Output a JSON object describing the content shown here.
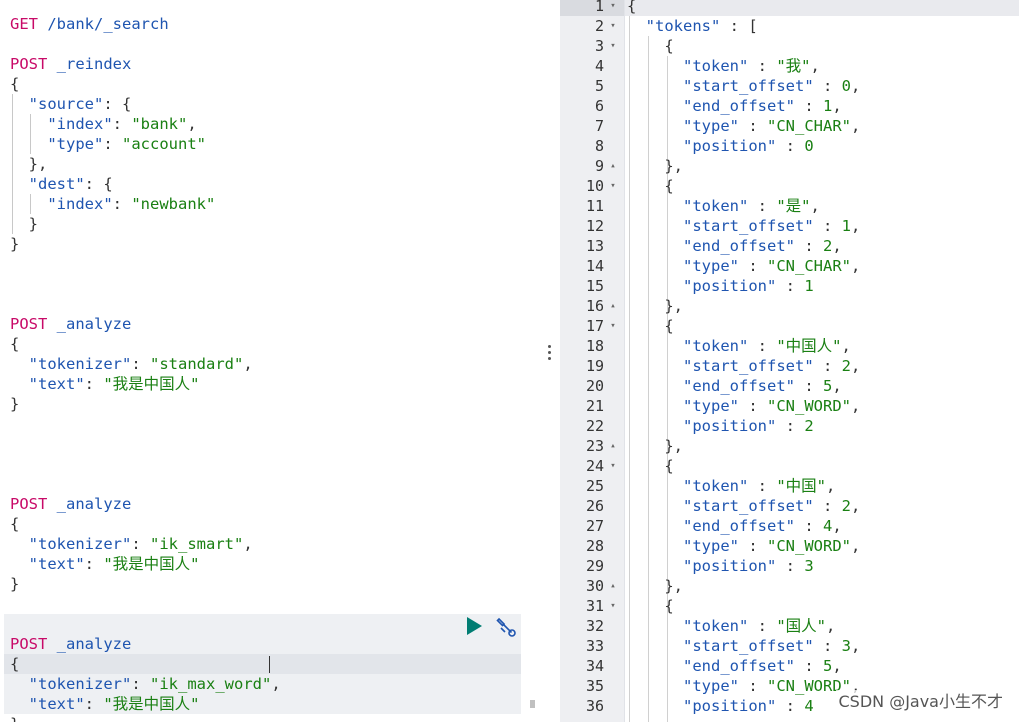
{
  "request_editor": {
    "lines": [
      [
        {
          "c": "tok-method",
          "t": "GET"
        },
        {
          "c": "tok-punc",
          "t": " "
        },
        {
          "c": "tok-path",
          "t": "/bank/_search"
        }
      ],
      [],
      [
        {
          "c": "tok-method",
          "t": "POST"
        },
        {
          "c": "tok-punc",
          "t": " "
        },
        {
          "c": "tok-path",
          "t": "_reindex"
        }
      ],
      [
        {
          "c": "tok-punc",
          "t": "{"
        }
      ],
      [
        {
          "c": "tok-punc",
          "t": "  "
        },
        {
          "c": "tok-key",
          "t": "\"source\""
        },
        {
          "c": "tok-punc",
          "t": ": {"
        }
      ],
      [
        {
          "c": "tok-punc",
          "t": "    "
        },
        {
          "c": "tok-key",
          "t": "\"index\""
        },
        {
          "c": "tok-punc",
          "t": ": "
        },
        {
          "c": "tok-str",
          "t": "\"bank\""
        },
        {
          "c": "tok-punc",
          "t": ","
        }
      ],
      [
        {
          "c": "tok-punc",
          "t": "    "
        },
        {
          "c": "tok-key",
          "t": "\"type\""
        },
        {
          "c": "tok-punc",
          "t": ": "
        },
        {
          "c": "tok-str",
          "t": "\"account\""
        }
      ],
      [
        {
          "c": "tok-punc",
          "t": "  },"
        }
      ],
      [
        {
          "c": "tok-punc",
          "t": "  "
        },
        {
          "c": "tok-key",
          "t": "\"dest\""
        },
        {
          "c": "tok-punc",
          "t": ": {"
        }
      ],
      [
        {
          "c": "tok-punc",
          "t": "    "
        },
        {
          "c": "tok-key",
          "t": "\"index\""
        },
        {
          "c": "tok-punc",
          "t": ": "
        },
        {
          "c": "tok-str",
          "t": "\"newbank\""
        }
      ],
      [
        {
          "c": "tok-punc",
          "t": "  }"
        }
      ],
      [
        {
          "c": "tok-punc",
          "t": "}"
        }
      ],
      [],
      [],
      [],
      [
        {
          "c": "tok-method",
          "t": "POST"
        },
        {
          "c": "tok-punc",
          "t": " "
        },
        {
          "c": "tok-path",
          "t": "_analyze"
        }
      ],
      [
        {
          "c": "tok-punc",
          "t": "{"
        }
      ],
      [
        {
          "c": "tok-punc",
          "t": "  "
        },
        {
          "c": "tok-key",
          "t": "\"tokenizer\""
        },
        {
          "c": "tok-punc",
          "t": ": "
        },
        {
          "c": "tok-str",
          "t": "\"standard\""
        },
        {
          "c": "tok-punc",
          "t": ","
        }
      ],
      [
        {
          "c": "tok-punc",
          "t": "  "
        },
        {
          "c": "tok-key",
          "t": "\"text\""
        },
        {
          "c": "tok-punc",
          "t": ": "
        },
        {
          "c": "tok-str",
          "t": "\"我是中国人\""
        }
      ],
      [
        {
          "c": "tok-punc",
          "t": "}"
        }
      ],
      [],
      [],
      [],
      [],
      [
        {
          "c": "tok-method",
          "t": "POST"
        },
        {
          "c": "tok-punc",
          "t": " "
        },
        {
          "c": "tok-path",
          "t": "_analyze"
        }
      ],
      [
        {
          "c": "tok-punc",
          "t": "{"
        }
      ],
      [
        {
          "c": "tok-punc",
          "t": "  "
        },
        {
          "c": "tok-key",
          "t": "\"tokenizer\""
        },
        {
          "c": "tok-punc",
          "t": ": "
        },
        {
          "c": "tok-str",
          "t": "\"ik_smart\""
        },
        {
          "c": "tok-punc",
          "t": ","
        }
      ],
      [
        {
          "c": "tok-punc",
          "t": "  "
        },
        {
          "c": "tok-key",
          "t": "\"text\""
        },
        {
          "c": "tok-punc",
          "t": ": "
        },
        {
          "c": "tok-str",
          "t": "\"我是中国人\""
        }
      ],
      [
        {
          "c": "tok-punc",
          "t": "}"
        }
      ],
      [],
      [],
      [
        {
          "c": "tok-method",
          "t": "POST"
        },
        {
          "c": "tok-punc",
          "t": " "
        },
        {
          "c": "tok-path",
          "t": "_analyze"
        }
      ],
      [
        {
          "c": "tok-punc",
          "t": "{"
        }
      ],
      [
        {
          "c": "tok-punc",
          "t": "  "
        },
        {
          "c": "tok-key",
          "t": "\"tokenizer\""
        },
        {
          "c": "tok-punc",
          "t": ": "
        },
        {
          "c": "tok-str",
          "t": "\"ik_max_word\""
        },
        {
          "c": "tok-punc",
          "t": ","
        }
      ],
      [
        {
          "c": "tok-punc",
          "t": "  "
        },
        {
          "c": "tok-key",
          "t": "\"text\""
        },
        {
          "c": "tok-punc",
          "t": ": "
        },
        {
          "c": "tok-str",
          "t": "\"我是中国人\""
        }
      ],
      [
        {
          "c": "tok-punc",
          "t": "}"
        }
      ]
    ],
    "run_icon": "play-icon",
    "settings_icon": "wrench-icon",
    "run_color": "#017d73"
  },
  "response_viewer": {
    "line_numbers": [
      "1",
      "2",
      "3",
      "4",
      "5",
      "6",
      "7",
      "8",
      "9",
      "10",
      "11",
      "12",
      "13",
      "14",
      "15",
      "16",
      "17",
      "18",
      "19",
      "20",
      "21",
      "22",
      "23",
      "24",
      "25",
      "26",
      "27",
      "28",
      "29",
      "30",
      "31",
      "32",
      "33",
      "34",
      "35",
      "36"
    ],
    "lines": [
      [
        {
          "c": "tok-punc",
          "t": "{"
        }
      ],
      [
        {
          "c": "tok-punc",
          "t": "  "
        },
        {
          "c": "tok-key",
          "t": "\"tokens\""
        },
        {
          "c": "tok-punc",
          "t": " : ["
        }
      ],
      [
        {
          "c": "tok-punc",
          "t": "    {"
        }
      ],
      [
        {
          "c": "tok-punc",
          "t": "      "
        },
        {
          "c": "tok-key",
          "t": "\"token\""
        },
        {
          "c": "tok-punc",
          "t": " : "
        },
        {
          "c": "tok-str",
          "t": "\"我\""
        },
        {
          "c": "tok-punc",
          "t": ","
        }
      ],
      [
        {
          "c": "tok-punc",
          "t": "      "
        },
        {
          "c": "tok-key",
          "t": "\"start_offset\""
        },
        {
          "c": "tok-punc",
          "t": " : "
        },
        {
          "c": "tok-num",
          "t": "0"
        },
        {
          "c": "tok-punc",
          "t": ","
        }
      ],
      [
        {
          "c": "tok-punc",
          "t": "      "
        },
        {
          "c": "tok-key",
          "t": "\"end_offset\""
        },
        {
          "c": "tok-punc",
          "t": " : "
        },
        {
          "c": "tok-num",
          "t": "1"
        },
        {
          "c": "tok-punc",
          "t": ","
        }
      ],
      [
        {
          "c": "tok-punc",
          "t": "      "
        },
        {
          "c": "tok-key",
          "t": "\"type\""
        },
        {
          "c": "tok-punc",
          "t": " : "
        },
        {
          "c": "tok-str",
          "t": "\"CN_CHAR\""
        },
        {
          "c": "tok-punc",
          "t": ","
        }
      ],
      [
        {
          "c": "tok-punc",
          "t": "      "
        },
        {
          "c": "tok-key",
          "t": "\"position\""
        },
        {
          "c": "tok-punc",
          "t": " : "
        },
        {
          "c": "tok-num",
          "t": "0"
        }
      ],
      [
        {
          "c": "tok-punc",
          "t": "    },"
        }
      ],
      [
        {
          "c": "tok-punc",
          "t": "    {"
        }
      ],
      [
        {
          "c": "tok-punc",
          "t": "      "
        },
        {
          "c": "tok-key",
          "t": "\"token\""
        },
        {
          "c": "tok-punc",
          "t": " : "
        },
        {
          "c": "tok-str",
          "t": "\"是\""
        },
        {
          "c": "tok-punc",
          "t": ","
        }
      ],
      [
        {
          "c": "tok-punc",
          "t": "      "
        },
        {
          "c": "tok-key",
          "t": "\"start_offset\""
        },
        {
          "c": "tok-punc",
          "t": " : "
        },
        {
          "c": "tok-num",
          "t": "1"
        },
        {
          "c": "tok-punc",
          "t": ","
        }
      ],
      [
        {
          "c": "tok-punc",
          "t": "      "
        },
        {
          "c": "tok-key",
          "t": "\"end_offset\""
        },
        {
          "c": "tok-punc",
          "t": " : "
        },
        {
          "c": "tok-num",
          "t": "2"
        },
        {
          "c": "tok-punc",
          "t": ","
        }
      ],
      [
        {
          "c": "tok-punc",
          "t": "      "
        },
        {
          "c": "tok-key",
          "t": "\"type\""
        },
        {
          "c": "tok-punc",
          "t": " : "
        },
        {
          "c": "tok-str",
          "t": "\"CN_CHAR\""
        },
        {
          "c": "tok-punc",
          "t": ","
        }
      ],
      [
        {
          "c": "tok-punc",
          "t": "      "
        },
        {
          "c": "tok-key",
          "t": "\"position\""
        },
        {
          "c": "tok-punc",
          "t": " : "
        },
        {
          "c": "tok-num",
          "t": "1"
        }
      ],
      [
        {
          "c": "tok-punc",
          "t": "    },"
        }
      ],
      [
        {
          "c": "tok-punc",
          "t": "    {"
        }
      ],
      [
        {
          "c": "tok-punc",
          "t": "      "
        },
        {
          "c": "tok-key",
          "t": "\"token\""
        },
        {
          "c": "tok-punc",
          "t": " : "
        },
        {
          "c": "tok-str",
          "t": "\"中国人\""
        },
        {
          "c": "tok-punc",
          "t": ","
        }
      ],
      [
        {
          "c": "tok-punc",
          "t": "      "
        },
        {
          "c": "tok-key",
          "t": "\"start_offset\""
        },
        {
          "c": "tok-punc",
          "t": " : "
        },
        {
          "c": "tok-num",
          "t": "2"
        },
        {
          "c": "tok-punc",
          "t": ","
        }
      ],
      [
        {
          "c": "tok-punc",
          "t": "      "
        },
        {
          "c": "tok-key",
          "t": "\"end_offset\""
        },
        {
          "c": "tok-punc",
          "t": " : "
        },
        {
          "c": "tok-num",
          "t": "5"
        },
        {
          "c": "tok-punc",
          "t": ","
        }
      ],
      [
        {
          "c": "tok-punc",
          "t": "      "
        },
        {
          "c": "tok-key",
          "t": "\"type\""
        },
        {
          "c": "tok-punc",
          "t": " : "
        },
        {
          "c": "tok-str",
          "t": "\"CN_WORD\""
        },
        {
          "c": "tok-punc",
          "t": ","
        }
      ],
      [
        {
          "c": "tok-punc",
          "t": "      "
        },
        {
          "c": "tok-key",
          "t": "\"position\""
        },
        {
          "c": "tok-punc",
          "t": " : "
        },
        {
          "c": "tok-num",
          "t": "2"
        }
      ],
      [
        {
          "c": "tok-punc",
          "t": "    },"
        }
      ],
      [
        {
          "c": "tok-punc",
          "t": "    {"
        }
      ],
      [
        {
          "c": "tok-punc",
          "t": "      "
        },
        {
          "c": "tok-key",
          "t": "\"token\""
        },
        {
          "c": "tok-punc",
          "t": " : "
        },
        {
          "c": "tok-str",
          "t": "\"中国\""
        },
        {
          "c": "tok-punc",
          "t": ","
        }
      ],
      [
        {
          "c": "tok-punc",
          "t": "      "
        },
        {
          "c": "tok-key",
          "t": "\"start_offset\""
        },
        {
          "c": "tok-punc",
          "t": " : "
        },
        {
          "c": "tok-num",
          "t": "2"
        },
        {
          "c": "tok-punc",
          "t": ","
        }
      ],
      [
        {
          "c": "tok-punc",
          "t": "      "
        },
        {
          "c": "tok-key",
          "t": "\"end_offset\""
        },
        {
          "c": "tok-punc",
          "t": " : "
        },
        {
          "c": "tok-num",
          "t": "4"
        },
        {
          "c": "tok-punc",
          "t": ","
        }
      ],
      [
        {
          "c": "tok-punc",
          "t": "      "
        },
        {
          "c": "tok-key",
          "t": "\"type\""
        },
        {
          "c": "tok-punc",
          "t": " : "
        },
        {
          "c": "tok-str",
          "t": "\"CN_WORD\""
        },
        {
          "c": "tok-punc",
          "t": ","
        }
      ],
      [
        {
          "c": "tok-punc",
          "t": "      "
        },
        {
          "c": "tok-key",
          "t": "\"position\""
        },
        {
          "c": "tok-punc",
          "t": " : "
        },
        {
          "c": "tok-num",
          "t": "3"
        }
      ],
      [
        {
          "c": "tok-punc",
          "t": "    },"
        }
      ],
      [
        {
          "c": "tok-punc",
          "t": "    {"
        }
      ],
      [
        {
          "c": "tok-punc",
          "t": "      "
        },
        {
          "c": "tok-key",
          "t": "\"token\""
        },
        {
          "c": "tok-punc",
          "t": " : "
        },
        {
          "c": "tok-str",
          "t": "\"国人\""
        },
        {
          "c": "tok-punc",
          "t": ","
        }
      ],
      [
        {
          "c": "tok-punc",
          "t": "      "
        },
        {
          "c": "tok-key",
          "t": "\"start_offset\""
        },
        {
          "c": "tok-punc",
          "t": " : "
        },
        {
          "c": "tok-num",
          "t": "3"
        },
        {
          "c": "tok-punc",
          "t": ","
        }
      ],
      [
        {
          "c": "tok-punc",
          "t": "      "
        },
        {
          "c": "tok-key",
          "t": "\"end_offset\""
        },
        {
          "c": "tok-punc",
          "t": " : "
        },
        {
          "c": "tok-num",
          "t": "5"
        },
        {
          "c": "tok-punc",
          "t": ","
        }
      ],
      [
        {
          "c": "tok-punc",
          "t": "      "
        },
        {
          "c": "tok-key",
          "t": "\"type\""
        },
        {
          "c": "tok-punc",
          "t": " : "
        },
        {
          "c": "tok-str",
          "t": "\"CN_WORD\""
        },
        {
          "c": "tok-punc",
          "t": ","
        }
      ],
      [
        {
          "c": "tok-punc",
          "t": "      "
        },
        {
          "c": "tok-key",
          "t": "\"position\""
        },
        {
          "c": "tok-punc",
          "t": " : "
        },
        {
          "c": "tok-num",
          "t": "4"
        }
      ]
    ],
    "fold_markers": {
      "1": "down",
      "2": "down",
      "3": "down",
      "9": "up",
      "10": "down",
      "16": "up",
      "17": "down",
      "23": "up",
      "24": "down",
      "30": "up",
      "31": "down"
    }
  },
  "watermark": "CSDN @Java小生不才"
}
